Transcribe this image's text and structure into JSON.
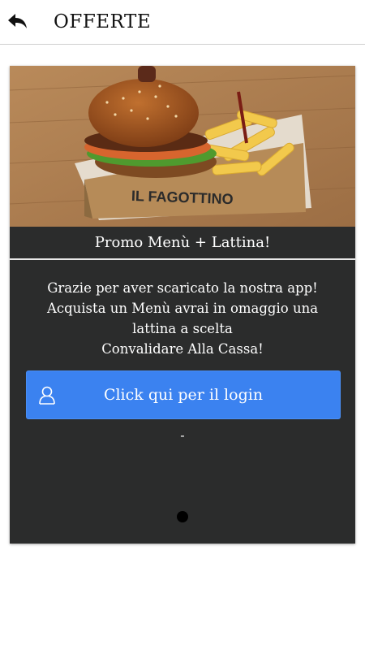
{
  "header": {
    "title": "OFFERTE",
    "back_icon": "back-arrow-icon"
  },
  "offer": {
    "image_text": "IL FAGOTTINO",
    "promo_title": "Promo Menù + Lattina!",
    "description_lines": [
      "Grazie per aver scaricato la nostra app!",
      "Acquista un Menù avrai in omaggio una lattina a scelta",
      "Convalidare Alla Cassa!"
    ],
    "login_button": {
      "label": "Click qui per il login",
      "icon": "user-icon"
    },
    "separator_text": "-",
    "pagination": {
      "current": 1,
      "total": 1
    }
  },
  "colors": {
    "card_background": "#2b2c2c",
    "button_blue": "#3b82f0",
    "text_on_dark": "#ffffff"
  }
}
